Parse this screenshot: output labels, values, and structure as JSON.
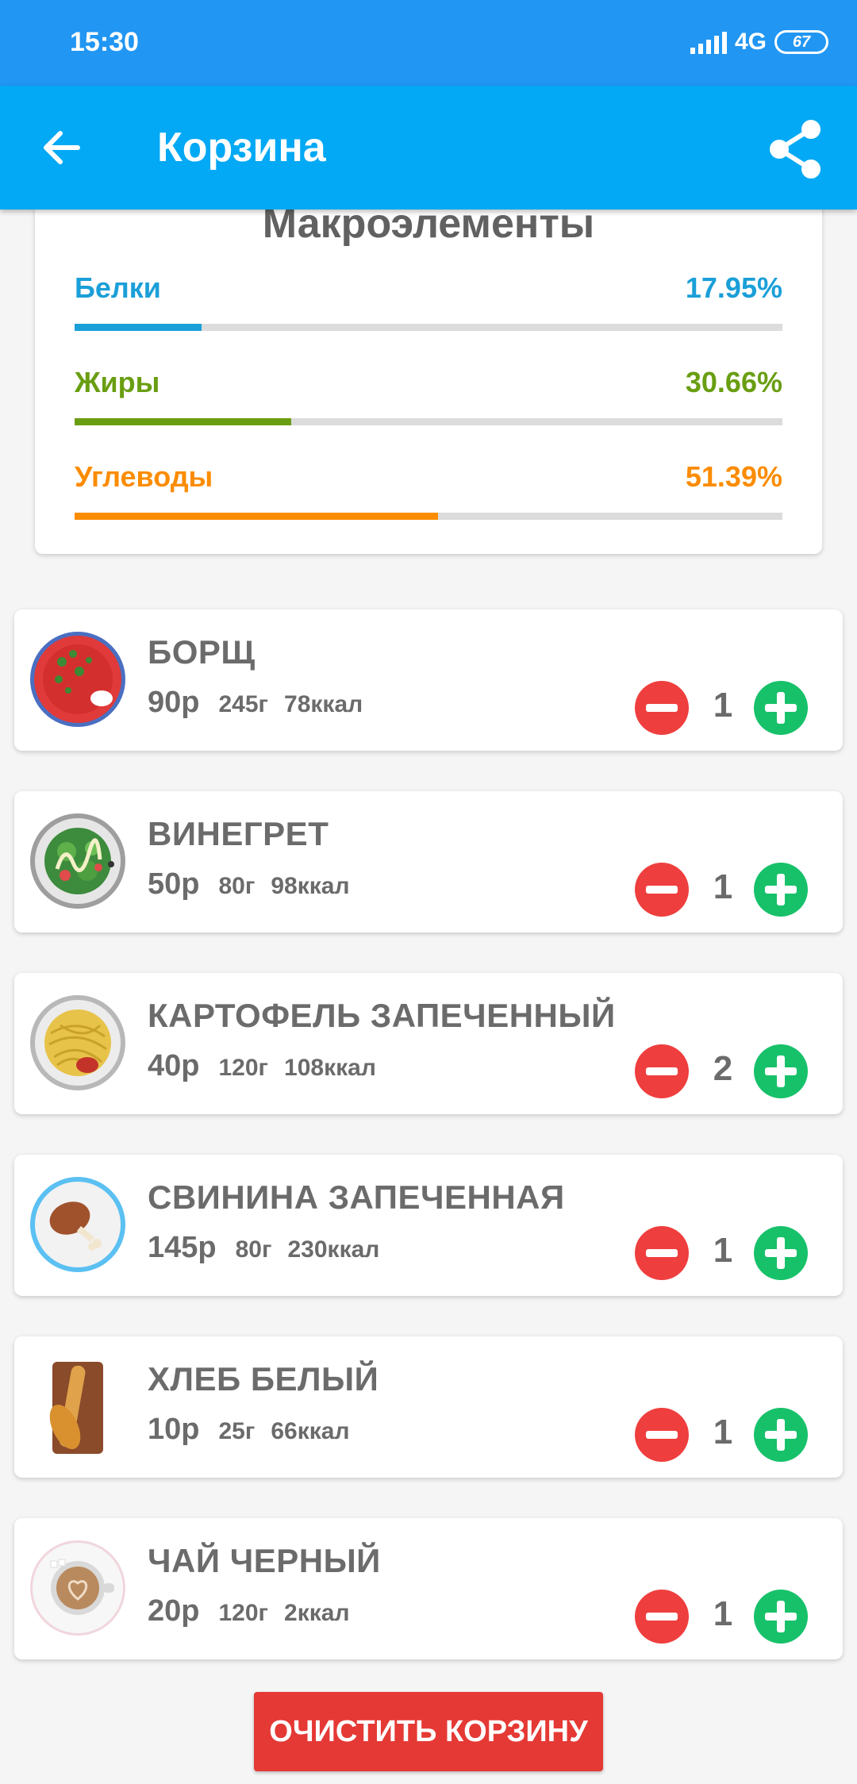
{
  "status_bar": {
    "time": "15:30",
    "network": "4G",
    "battery": "67"
  },
  "app_bar": {
    "title": "Корзина"
  },
  "macros": {
    "title": "Макроэлементы",
    "items": [
      {
        "label": "Белки",
        "value": "17.95%",
        "percent": 17.95,
        "color": "#1a9fd8"
      },
      {
        "label": "Жиры",
        "value": "30.66%",
        "percent": 30.66,
        "color": "#6a9e12"
      },
      {
        "label": "Углеводы",
        "value": "51.39%",
        "percent": 51.39,
        "color": "#fb8c00"
      }
    ]
  },
  "cart": {
    "items": [
      {
        "name": "БОРЩ",
        "price": "90р",
        "weight": "245г",
        "kcal": "78ккал",
        "qty": "1",
        "icon": "borscht-icon"
      },
      {
        "name": "ВИНЕГРЕТ",
        "price": "50р",
        "weight": "80г",
        "kcal": "98ккал",
        "qty": "1",
        "icon": "salad-icon"
      },
      {
        "name": "КАРТОФЕЛЬ ЗАПЕЧЕННЫЙ",
        "price": "40р",
        "weight": "120г",
        "kcal": "108ккал",
        "qty": "2",
        "icon": "pasta-icon"
      },
      {
        "name": "СВИНИНА ЗАПЕЧЕННАЯ",
        "price": "145р",
        "weight": "80г",
        "kcal": "230ккал",
        "qty": "1",
        "icon": "meat-leg-icon"
      },
      {
        "name": "ХЛЕБ БЕЛЫЙ",
        "price": "10р",
        "weight": "25г",
        "kcal": "66ккал",
        "qty": "1",
        "icon": "bread-icon"
      },
      {
        "name": "ЧАЙ ЧЕРНЫЙ",
        "price": "20р",
        "weight": "120г",
        "kcal": "2ккал",
        "qty": "1",
        "icon": "tea-cup-icon"
      }
    ]
  },
  "clear_button": "ОЧИСТИТЬ КОРЗИНУ",
  "colors": {
    "status_bar": "#2196f3",
    "app_bar": "#03a9f4",
    "minus": "#ef3e3e",
    "plus": "#17c16a",
    "clear": "#e53935"
  }
}
